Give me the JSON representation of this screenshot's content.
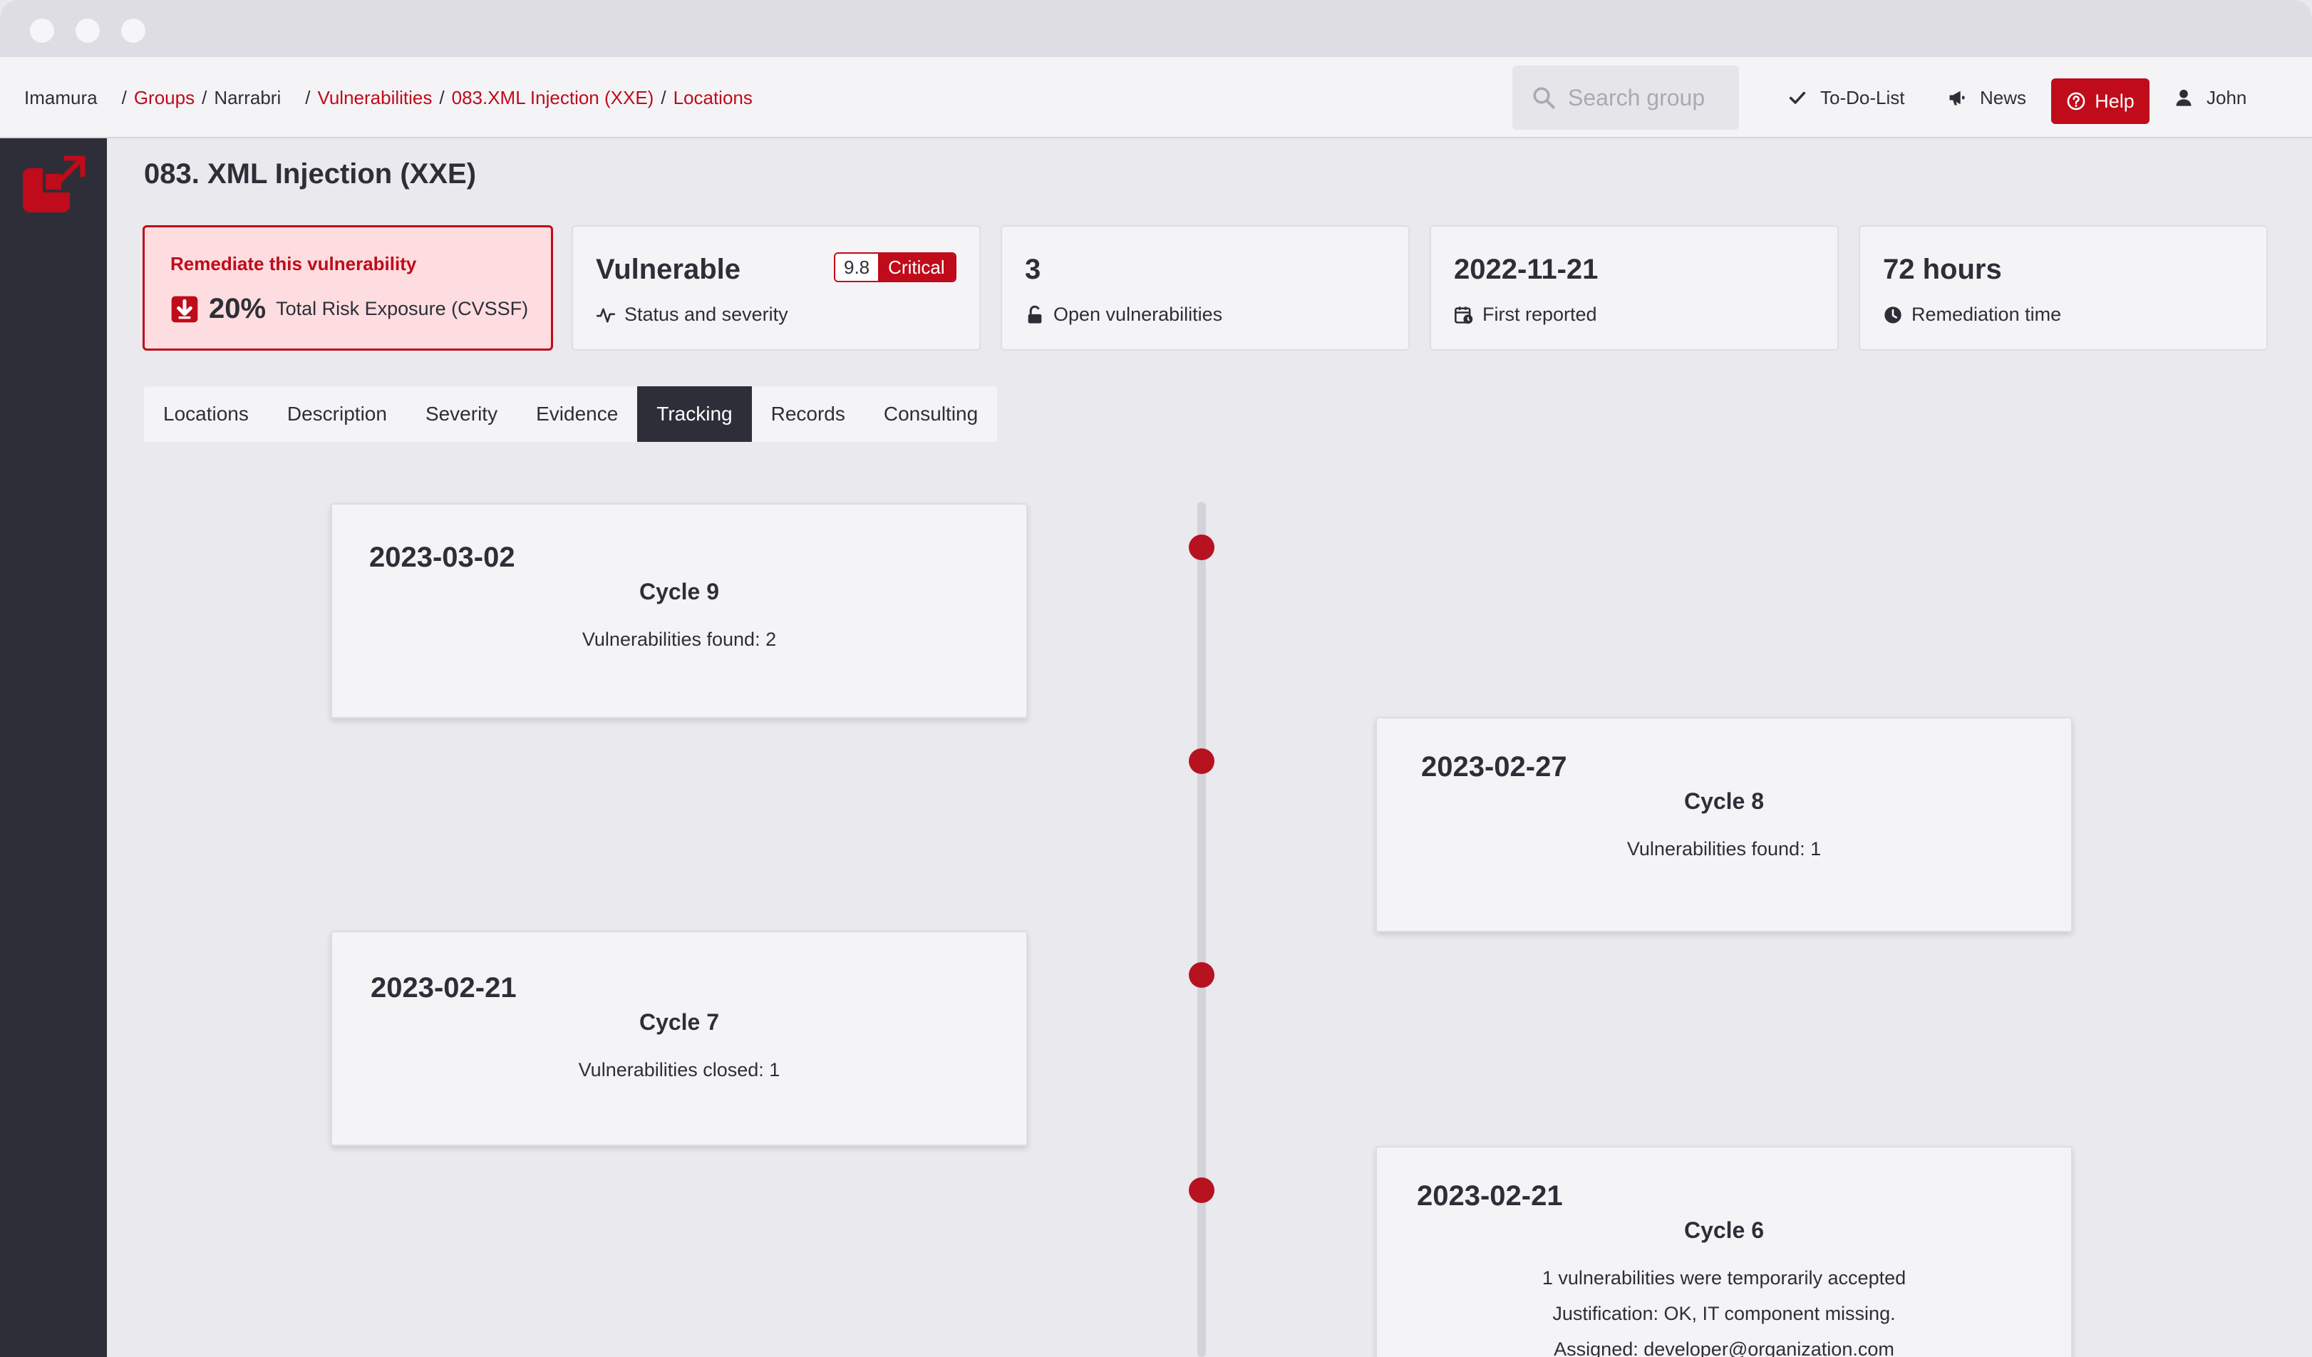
{
  "breadcrumb": {
    "org": "Imamura",
    "groups": "Groups",
    "group": "Narrabri",
    "vulnerabilities": "Vulnerabilities",
    "finding": "083.XML Injection (XXE)",
    "locations": "Locations",
    "separator": "/"
  },
  "search": {
    "placeholder": "Search group",
    "icon": "search-icon"
  },
  "topbar": {
    "todo": {
      "label": "To-Do-List",
      "icon": "check-icon"
    },
    "news": {
      "label": "News",
      "icon": "megaphone-icon"
    },
    "help": {
      "label": "Help",
      "icon": "question-circle-icon"
    },
    "user": {
      "label": "John",
      "icon": "user-icon"
    }
  },
  "page": {
    "title": "083. XML Injection (XXE)"
  },
  "indicators": {
    "risk": {
      "title": "Remediate this vulnerability",
      "percent": "20%",
      "label": "Total Risk Exposure (CVSSF)",
      "icon": "arrow-down-square-icon"
    },
    "status": {
      "value": "Vulnerable",
      "label": "Status and severity",
      "score": "9.8",
      "severity": "Critical",
      "icon": "pulse-icon"
    },
    "open": {
      "value": "3",
      "label": "Open vulnerabilities",
      "icon": "unlock-icon"
    },
    "reported": {
      "value": "2022-11-21",
      "label": "First reported",
      "icon": "calendar-clock-icon"
    },
    "remediation": {
      "value": "72 hours",
      "label": "Remediation time",
      "icon": "clock-icon"
    }
  },
  "tabs": [
    {
      "label": "Locations",
      "active": false
    },
    {
      "label": "Description",
      "active": false
    },
    {
      "label": "Severity",
      "active": false
    },
    {
      "label": "Evidence",
      "active": false
    },
    {
      "label": "Tracking",
      "active": true
    },
    {
      "label": "Records",
      "active": false
    },
    {
      "label": "Consulting",
      "active": false
    }
  ],
  "tracking": [
    {
      "date": "2023-03-02",
      "cycle": "Cycle 9",
      "lines": [
        "Vulnerabilities found: 2"
      ]
    },
    {
      "date": "2023-02-27",
      "cycle": "Cycle 8",
      "lines": [
        "Vulnerabilities found: 1"
      ]
    },
    {
      "date": "2023-02-21",
      "cycle": "Cycle 7",
      "lines": [
        "Vulnerabilities closed: 1"
      ]
    },
    {
      "date": "2023-02-21",
      "cycle": "Cycle 6",
      "lines": [
        "1 vulnerabilities were temporarily accepted",
        "Justification: OK, IT component missing.",
        "Assigned: developer@organization.com"
      ]
    }
  ],
  "colors": {
    "accent": "#bf0b1a",
    "sidebar": "#2e2e38",
    "background": "#e9e9ee"
  }
}
